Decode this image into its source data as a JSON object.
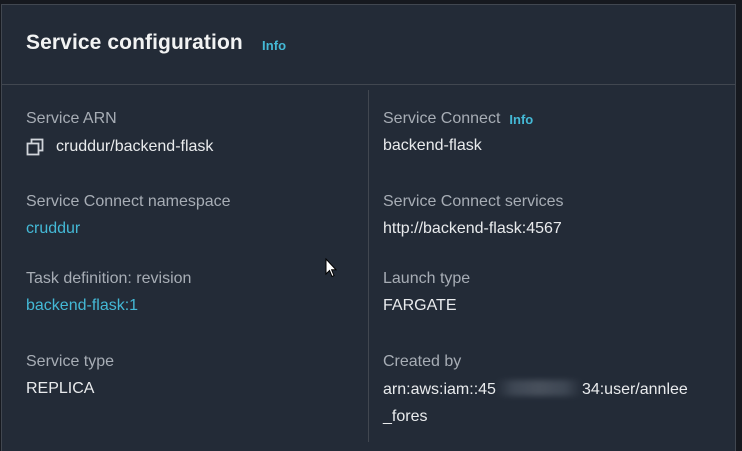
{
  "header": {
    "title": "Service configuration",
    "info_label": "Info"
  },
  "left_column": {
    "service_arn": {
      "label": "Service ARN",
      "value": "cruddur/backend-flask",
      "icon": "copy-icon"
    },
    "service_connect_namespace": {
      "label": "Service Connect namespace",
      "value": "cruddur"
    },
    "task_definition": {
      "label": "Task definition: revision",
      "value": "backend-flask:1"
    },
    "service_type": {
      "label": "Service type",
      "value": "REPLICA"
    }
  },
  "right_column": {
    "service_connect": {
      "label": "Service Connect",
      "info_label": "Info",
      "value": "backend-flask"
    },
    "service_connect_services": {
      "label": "Service Connect services",
      "value": "http://backend-flask:4567"
    },
    "launch_type": {
      "label": "Launch type",
      "value": "FARGATE"
    },
    "created_by": {
      "label": "Created by",
      "value_prefix": "arn:aws:iam::45",
      "value_suffix": "34:user/annlee",
      "value_line2": "_fores"
    }
  },
  "colors": {
    "background": "#16191f",
    "panel": "#232b37",
    "border": "#414750",
    "link": "#44b9d6",
    "label": "#a7adb5",
    "value": "#e9ebed"
  }
}
